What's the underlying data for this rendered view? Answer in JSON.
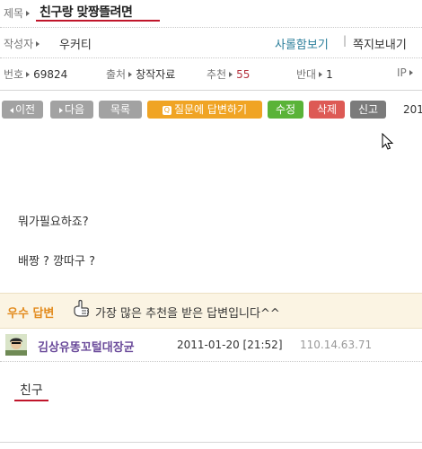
{
  "title": {
    "label": "제목",
    "text": "친구랑 맞짱뜰려면"
  },
  "author": {
    "label": "작성자",
    "name": "우커티",
    "sarang_link": "사롤함보기",
    "separator": "|",
    "message_link": "쪽지보내기"
  },
  "meta": {
    "number_label": "번호",
    "number_value": "69824",
    "source_label": "출처",
    "source_value": "창작자료",
    "recommend_label": "추천",
    "recommend_value": "55",
    "oppose_label": "반대",
    "oppose_value": "1",
    "ip_label": "IP"
  },
  "buttons": {
    "prev": "이전",
    "next": "다음",
    "list": "목록",
    "answer": "질문에 답변하기",
    "answer_icon_glyph": "Q",
    "edit": "수정",
    "delete": "삭제",
    "report": "신고"
  },
  "date_cut": "201",
  "body": {
    "line1": "뭐가필요하죠?",
    "line2": "배짱 ? 깡따구 ?"
  },
  "best_answer": {
    "label": "우수 답변",
    "description": "가장 많은 추천을 받은 답변입니다^^"
  },
  "answer": {
    "author": "김상유똥꼬털대장균",
    "date": "2011-01-20 [21:52]",
    "ip": "110.14.63.71",
    "text": "친구"
  },
  "icons": {
    "thumb": "thumb-pointer-icon",
    "cursor": "mouse-cursor-icon",
    "avatar": "user-avatar-icon"
  },
  "colors": {
    "accent_red": "#c0152a",
    "orange": "#f0a424",
    "green": "#5ab338",
    "red": "#dd5a55",
    "link_teal": "#2a7e9a",
    "purple_name": "#6a4a9a"
  }
}
